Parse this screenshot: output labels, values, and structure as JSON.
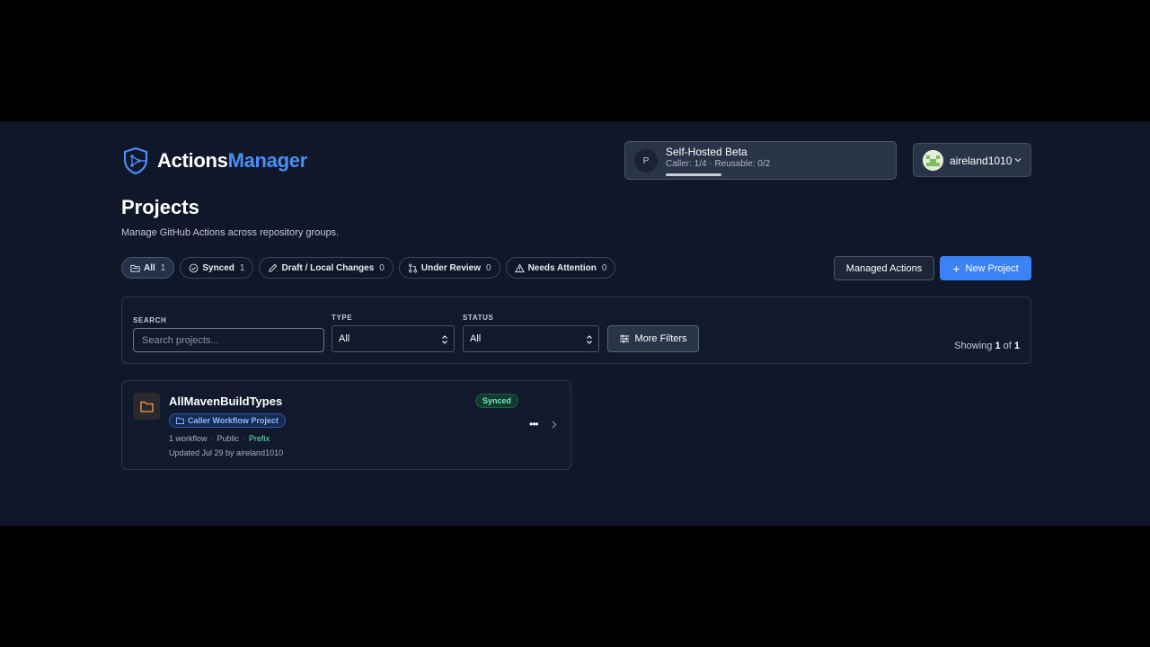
{
  "brand": {
    "part1": "Actions",
    "part2": "Manager"
  },
  "plan": {
    "avatar": "P",
    "title": "Self-Hosted Beta",
    "usage": "Caller: 1/4 · Reusable: 0/2",
    "progress": 0.25
  },
  "user": {
    "name": "aireland1010"
  },
  "page": {
    "title": "Projects",
    "subtitle": "Manage GitHub Actions across repository groups."
  },
  "chips": [
    {
      "label": "All",
      "count": "1",
      "icon": "folder-icon"
    },
    {
      "label": "Synced",
      "count": "1",
      "icon": "check-circle-icon"
    },
    {
      "label": "Draft / Local Changes",
      "count": "0",
      "icon": "pencil-icon"
    },
    {
      "label": "Under Review",
      "count": "0",
      "icon": "pull-request-icon"
    },
    {
      "label": "Needs Attention",
      "count": "0",
      "icon": "warning-icon"
    }
  ],
  "actions": {
    "managed": "Managed Actions",
    "new_project": "New Project"
  },
  "filters": {
    "search_label": "SEARCH",
    "search_placeholder": "Search projects...",
    "type_label": "TYPE",
    "type_value": "All",
    "status_label": "STATUS",
    "status_value": "All",
    "more_filters": "More Filters",
    "showing_prefix": "Showing",
    "showing_count": "1",
    "showing_of": "of",
    "showing_total": "1"
  },
  "project": {
    "name": "AllMavenBuildTypes",
    "type": "Caller Workflow Project",
    "status": "Synced",
    "workflows": "1 workflow",
    "visibility": "Public",
    "naming": "Prefix",
    "updated": "Updated Jul 29 by aireland1010"
  },
  "colors": {
    "accent": "#3b82f6",
    "brand_blue": "#4d8ef5",
    "success": "#6ee7b7",
    "folder": "#f59e42"
  }
}
